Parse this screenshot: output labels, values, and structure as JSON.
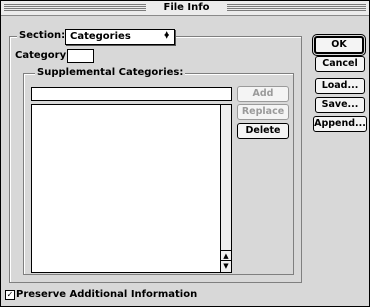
{
  "window": {
    "title": "File Info"
  },
  "section": {
    "label": "Section:",
    "selected": "Categories"
  },
  "category": {
    "label": "Category:",
    "value": ""
  },
  "supplemental": {
    "label": "Supplemental Categories:",
    "input_value": "",
    "items": []
  },
  "buttons": {
    "add": "Add",
    "replace": "Replace",
    "delete": "Delete",
    "ok": "OK",
    "cancel": "Cancel",
    "load": "Load...",
    "save": "Save...",
    "append": "Append..."
  },
  "preserve": {
    "label": "Preserve Additional Information",
    "checked": true
  }
}
